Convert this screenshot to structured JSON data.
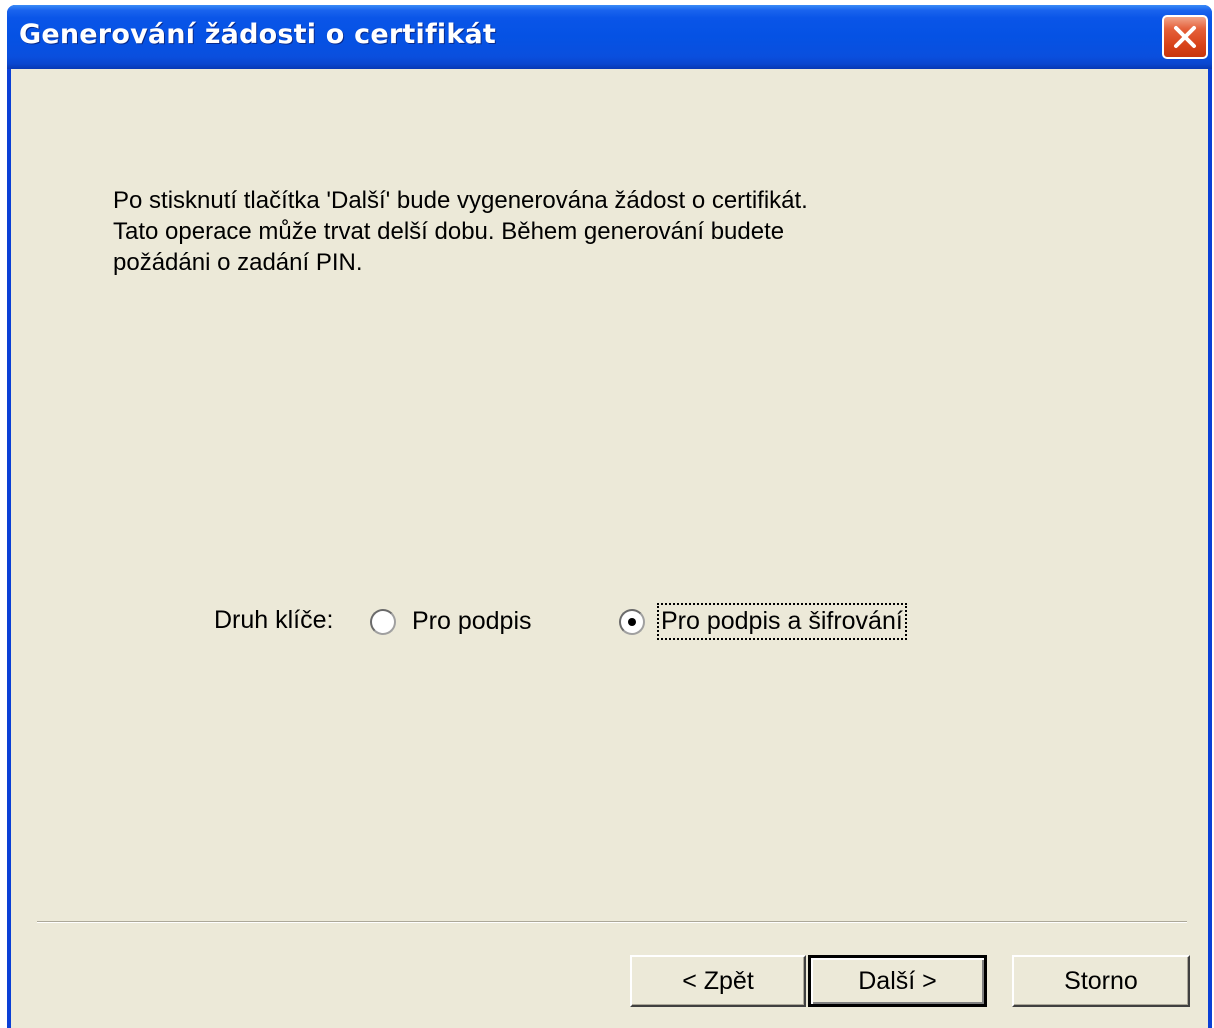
{
  "window": {
    "title": "Generování žádosti o certifikát",
    "close_icon": "close-x-icon"
  },
  "content": {
    "instruction": "Po stisknutí tlačítka 'Další' bude vygenerována žádost o certifikát.\nTato operace může trvat delší dobu. Během generování budete\npožádáni o zadání PIN.",
    "key_type": {
      "label": "Druh klíče:",
      "options": [
        {
          "label": "Pro podpis",
          "selected": false
        },
        {
          "label": "Pro podpis a šifrování",
          "selected": true
        }
      ]
    }
  },
  "buttons": {
    "back": "< Zpět",
    "next": "Další >",
    "cancel": "Storno"
  },
  "colors": {
    "titlebar": "#0552e4",
    "client_bg": "#ece9d8",
    "close_button": "#d8431a"
  }
}
